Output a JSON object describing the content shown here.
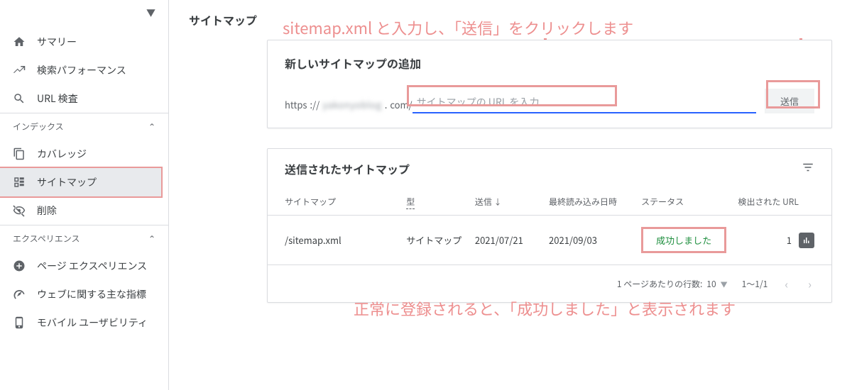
{
  "sidebar": {
    "items_main": [
      {
        "icon": "home",
        "label": "サマリー"
      },
      {
        "icon": "trend",
        "label": "検索パフォーマンス"
      },
      {
        "icon": "search",
        "label": "URL 検査"
      }
    ],
    "section_index_label": "インデックス",
    "items_index": [
      {
        "icon": "copy",
        "label": "カバレッジ"
      },
      {
        "icon": "sitemap",
        "label": "サイトマップ",
        "active": true
      },
      {
        "icon": "eyeoff",
        "label": "削除"
      }
    ],
    "section_exp_label": "エクスペリエンス",
    "items_exp": [
      {
        "icon": "pluscircle",
        "label": "ページ エクスペリエンス"
      },
      {
        "icon": "gauge",
        "label": "ウェブに関する主な指標"
      },
      {
        "icon": "mobile",
        "label": "モバイル ユーザビリティ"
      }
    ]
  },
  "page": {
    "title": "サイトマップ"
  },
  "addCard": {
    "title": "新しいサイトマップの追加",
    "url_prefix_before": "https",
    "url_prefix_blur": "yakonyoblog",
    "url_prefix_after": "com/",
    "placeholder": "サイトマップの URL を入力",
    "submit": "送信"
  },
  "listCard": {
    "title": "送信されたサイトマップ",
    "headers": {
      "sitemap": "サイトマップ",
      "type": "型",
      "sent": "送信",
      "last_read": "最終読み込み日時",
      "status": "ステータス",
      "urls": "検出された URL"
    },
    "row": {
      "sitemap": "/sitemap.xml",
      "type": "サイトマップ",
      "sent": "2021/07/21",
      "last_read": "2021/09/03",
      "status": "成功しました",
      "urls": "1"
    },
    "pager": {
      "rows_label": "1 ページあたりの行数:",
      "rows_value": "10",
      "range": "1～1/1"
    }
  },
  "annotations": {
    "top": "sitemap.xml と入力し、「送信」をクリックします",
    "bottom": "正常に登録されると、「成功しました」と表示されます"
  }
}
